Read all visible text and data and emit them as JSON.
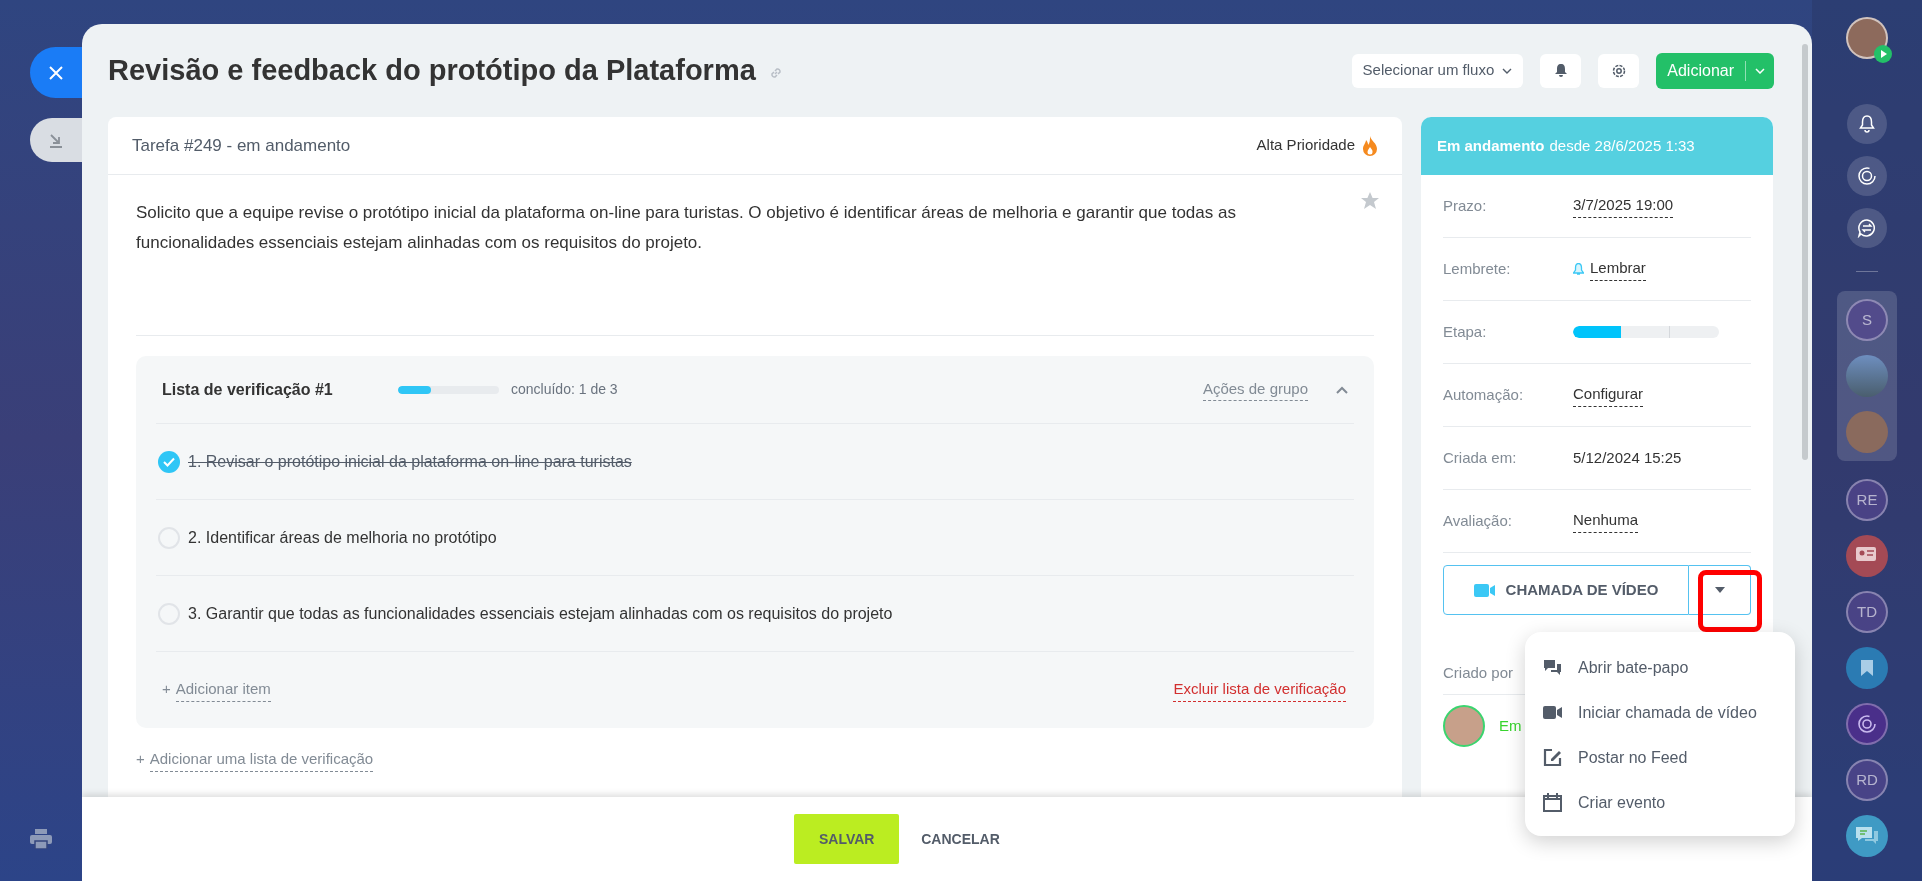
{
  "title": "Revisão e feedback do protótipo da Plataforma",
  "header": {
    "flow_select": "Selecionar um fluxo",
    "add_button": "Adicionar"
  },
  "task": {
    "heading": "Tarefa #249 - em andamento",
    "priority": "Alta Prioridade",
    "description": "Solicito que a equipe revise o protótipo inicial da plataforma on-line para turistas. O objetivo é identificar áreas de melhoria e garantir que todas as funcionalidades essenciais estejam alinhadas com os requisitos do projeto.",
    "checklist": {
      "title": "Lista de verificação #1",
      "level": 0.33,
      "progress": "concluído: 1 de 3",
      "group_actions": "Ações de grupo",
      "expanded": true,
      "items": [
        {
          "text": "1. Revisar o protótipo inicial da plataforma on-line para turistas",
          "checked": true
        },
        {
          "text": "2. Identificar áreas de melhoria no protótipo",
          "checked": false
        },
        {
          "text": "3. Garantir que todas as funcionalidades essenciais estejam alinhadas com os requisitos do projeto",
          "checked": false
        }
      ],
      "add_item": {
        "sign": "+",
        "label": "Adicionar item"
      },
      "delete": "Excluir lista de verificação"
    },
    "add_checklist": {
      "sign": "+",
      "label": "Adicionar uma lista de verificação"
    }
  },
  "status": {
    "label": "Em andamento",
    "since": "desde 28/6/2025 1:33"
  },
  "fields": [
    {
      "label": "Prazo:",
      "value": "3/7/2025 19:00",
      "kind": "link"
    },
    {
      "label": "Lembrete:",
      "value": "Lembrar",
      "kind": "reminder"
    },
    {
      "label": "Etapa:",
      "kind": "stage",
      "level": 0.33
    },
    {
      "label": "Automação:",
      "value": "Configurar",
      "kind": "link"
    },
    {
      "label": "Criada em:",
      "value": "5/12/2024 15:25",
      "kind": "text"
    },
    {
      "label": "Avaliação:",
      "value": "Nenhuma",
      "kind": "link"
    }
  ],
  "video_button": "CHAMADA DE VÍDEO",
  "created_by": {
    "label": "Criado por",
    "name": "Em"
  },
  "menu": [
    {
      "label": "Abrir bate-papo",
      "kind": "chat"
    },
    {
      "label": "Iniciar chamada de vídeo",
      "kind": "video"
    },
    {
      "label": "Postar no Feed",
      "kind": "post"
    },
    {
      "label": "Criar evento",
      "kind": "event"
    }
  ],
  "footer": {
    "save": "SALVAR",
    "cancel": "CANCELAR"
  },
  "right_bar": {
    "recent": [
      {
        "kind": "initials",
        "text": "S"
      },
      {
        "kind": "photo"
      },
      {
        "kind": "face"
      }
    ],
    "chats": [
      {
        "kind": "initials",
        "text": "RE"
      },
      {
        "kind": "card"
      },
      {
        "kind": "initials",
        "text": "TD"
      },
      {
        "kind": "bookmark"
      },
      {
        "kind": "spiral"
      },
      {
        "kind": "initials",
        "text": "RD"
      },
      {
        "kind": "chat"
      }
    ]
  }
}
